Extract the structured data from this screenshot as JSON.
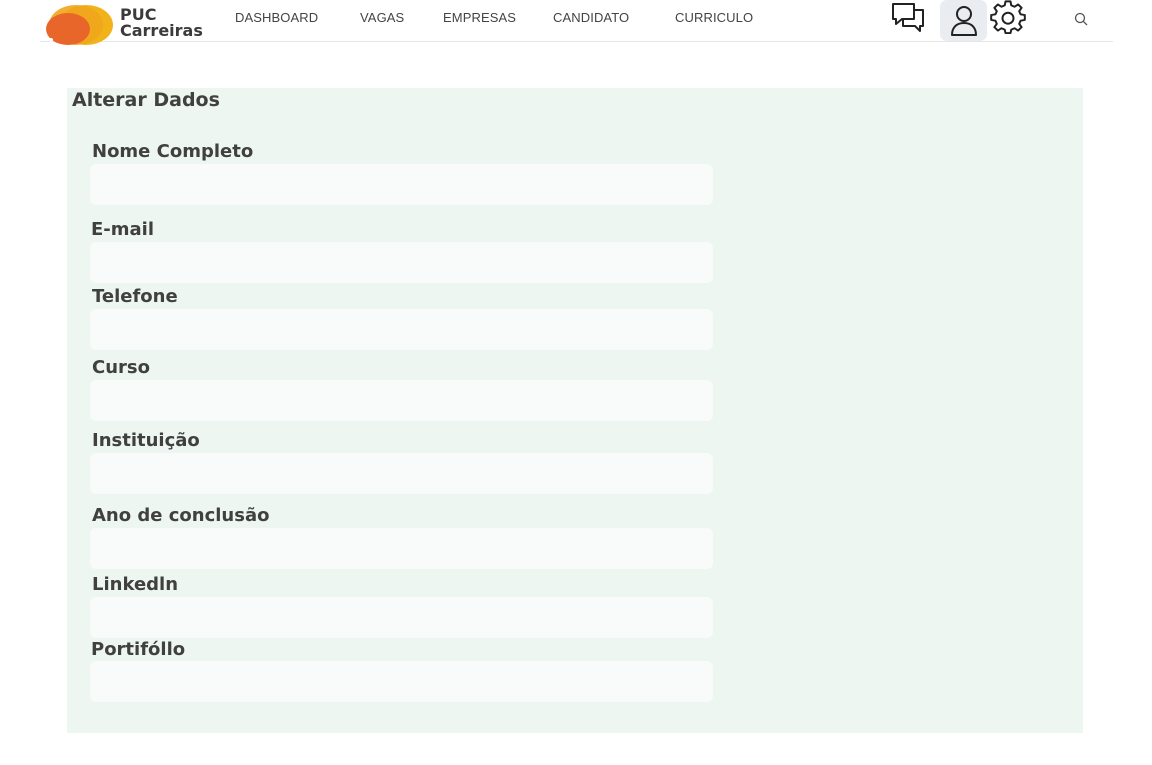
{
  "brand": {
    "line1": "PUC",
    "line2": "Carreiras",
    "colors": {
      "orange": "#e8662a",
      "yellow": "#f2b21a",
      "gold": "#f0a51c"
    }
  },
  "nav": {
    "items": [
      {
        "label": "DASHBOARD"
      },
      {
        "label": "VAGAS"
      },
      {
        "label": "EMPRESAS"
      },
      {
        "label": "CANDIDATO"
      },
      {
        "label": "CURRICULO"
      }
    ]
  },
  "header_icons": {
    "chat": "chat-bubbles-icon",
    "user": "user-icon",
    "settings": "gear-icon",
    "search": "search-icon"
  },
  "form": {
    "title": "Alterar Dados",
    "fields": [
      {
        "label": "Nome Completo",
        "value": ""
      },
      {
        "label": "E-mail",
        "value": ""
      },
      {
        "label": "Telefone",
        "value": ""
      },
      {
        "label": "Curso",
        "value": ""
      },
      {
        "label": "Instituição",
        "value": ""
      },
      {
        "label": "Ano de conclusão",
        "value": ""
      },
      {
        "label": "Linkedln",
        "value": ""
      },
      {
        "label": "Portifóllo",
        "value": ""
      }
    ]
  },
  "colors": {
    "panel_bg": "#eef6f1",
    "input_bg": "#f8fbf9",
    "active_icon_bg": "#e9ecf1"
  }
}
